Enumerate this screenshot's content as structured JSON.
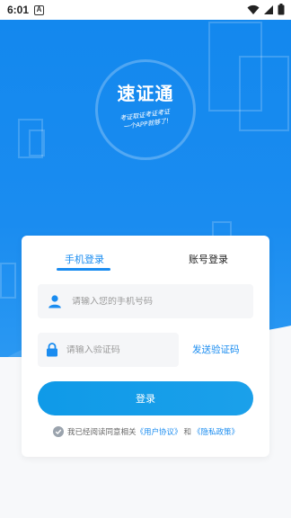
{
  "status_bar": {
    "time": "6:01",
    "notification_icon": "A"
  },
  "app": {
    "logo_title": "速证通",
    "logo_slogan_line1": "考证取证考证考证",
    "logo_slogan_line2": "一个APP就够了!"
  },
  "tabs": [
    {
      "label": "手机登录",
      "active": true
    },
    {
      "label": "账号登录",
      "active": false
    }
  ],
  "form": {
    "phone_placeholder": "请输入您的手机号码",
    "code_placeholder": "请输入验证码",
    "send_code_label": "发送验证码",
    "login_label": "登录"
  },
  "agreement": {
    "prefix": "我已经阅读同意相关",
    "user_agreement": "《用户协议》",
    "and": "和",
    "privacy_policy": "《隐私政策》"
  },
  "colors": {
    "primary": "#1a8cf0",
    "button": "#12a0e8"
  }
}
